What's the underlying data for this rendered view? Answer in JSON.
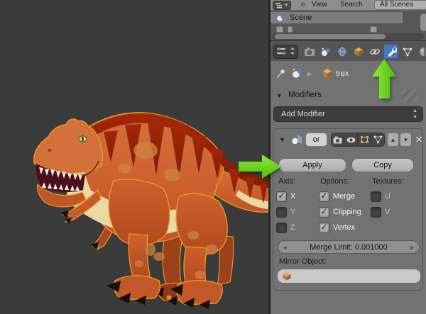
{
  "app": "blender-properties-mirror-modifier",
  "outliner": {
    "menu": {
      "view": "View",
      "search": "Search",
      "all_scenes": "All Scenes"
    },
    "tree": {
      "scene": "Scene"
    }
  },
  "properties_header": {
    "tabs": [
      "render",
      "scene",
      "world",
      "object",
      "constraints",
      "modifiers",
      "object-data",
      "material"
    ],
    "active_tab": "modifiers"
  },
  "breadcrumb": {
    "object": "trex"
  },
  "panel": {
    "title": "Modifiers",
    "add_modifier": "Add Modifier"
  },
  "modifier": {
    "name_value": "or",
    "apply": "Apply",
    "copy": "Copy",
    "columns": [
      {
        "title": "Axis:",
        "items": [
          {
            "label": "X",
            "checked": true
          },
          {
            "label": "Y",
            "checked": false
          },
          {
            "label": "Z",
            "checked": false
          }
        ]
      },
      {
        "title": "Options:",
        "items": [
          {
            "label": "Merge",
            "checked": true
          },
          {
            "label": "Clipping",
            "checked": true
          },
          {
            "label": "Vertex",
            "checked": true
          }
        ]
      },
      {
        "title": "Textures:",
        "items": [
          {
            "label": "U",
            "checked": false
          },
          {
            "label": "V",
            "checked": false
          }
        ]
      }
    ],
    "merge_limit": "Merge Limit: 0.001000",
    "mirror_object_label": "Mirror Object:"
  },
  "viewport": {
    "object_name": "trex"
  },
  "colors": {
    "viewport_bg": "#3b3b3b",
    "panel_bg": "#727272",
    "active_tab_blue": "#4d78b5",
    "annotation_green": "#5fd411",
    "selection_outline": "#f09a25",
    "dino_orange": "#c85a2c",
    "dino_ridge_red": "#8f1f05",
    "dino_belly": "#ead9a4"
  }
}
